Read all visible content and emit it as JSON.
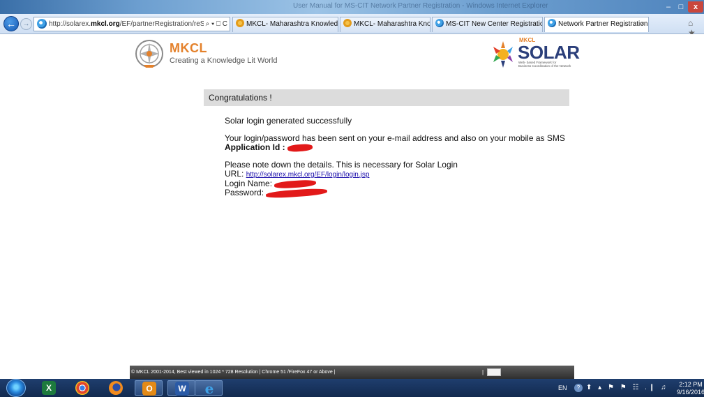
{
  "window": {
    "title": "User Manual for MS-CIT Network Partner Registration - Windows Internet Explorer",
    "minimize_icon": "–",
    "maximize_icon": "□",
    "close_icon": "x"
  },
  "navigation": {
    "back_icon": "←",
    "forward_icon": "→",
    "address_prefix": "http://solarex.",
    "address_host": "mkcl.org",
    "address_path": "/EF/partnerRegistration/reSe",
    "address_tools": "⌕ ▾ ⎕ C"
  },
  "tabs": [
    {
      "label": "MKCL- Maharashtra Knowledg...",
      "icon": "mkcl-icon",
      "active": false
    },
    {
      "label": "MKCL- Maharashtra Knowledg...",
      "icon": "mkcl-icon",
      "active": false
    },
    {
      "label": "MS-CIT New Center Registration",
      "icon": "ie-icon",
      "active": false
    },
    {
      "label": "Network Partner Registration",
      "icon": "ie-icon",
      "active": true,
      "close": "×"
    }
  ],
  "toolbar": {
    "icons": "⌂ ★ ⚙"
  },
  "header": {
    "brand": "MKCL",
    "tagline": "Creating a Knowledge Lit World",
    "solar_small": "MKCL",
    "solar_word": "SOLAR",
    "solar_sub1": "Web- based Framework for",
    "solar_sub2": "Business Coordination of the Network"
  },
  "panel": {
    "title": "Congratulations !",
    "success_message": "Solar login generated successfully",
    "sent_message": "Your login/password has been sent on your e-mail address and also on your mobile as SMS",
    "app_id_label": "Application Id :",
    "note": "Please note down the details. This is necessary for Solar Login",
    "url_label": "URL:",
    "url_link": "http://solarex.mkcl.org/EF/login/login.jsp",
    "login_name_label": "Login Name:",
    "password_label": "Password:"
  },
  "footer": {
    "text": "© MKCL 2001-2014,  Best viewed in 1024 * 728 Resolution | Chrome 51 /FireFox 47 or Above |",
    "separator": "|"
  },
  "taskbar": {
    "apps": [
      "excel",
      "chrome",
      "firefox",
      "outlook",
      "word",
      "internet-explorer"
    ],
    "language": "EN",
    "help": "?",
    "tray_icons": "⬆ ▴ ⚑ ⚑ ☷ .❙ ♫",
    "time": "2:12 PM",
    "date": "9/16/2016"
  }
}
